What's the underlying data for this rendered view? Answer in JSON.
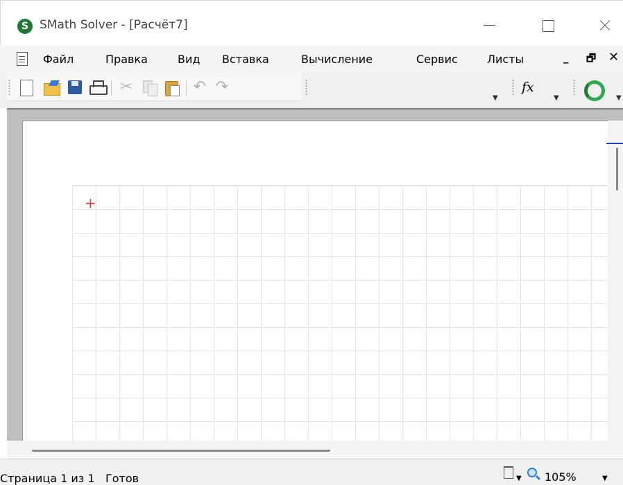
{
  "window": {
    "title": "SMath Solver - [Расчёт7]",
    "logo_letter": "S"
  },
  "menu": {
    "items": [
      "Файл",
      "Правка",
      "Вид",
      "Вставка",
      "Вычисление",
      "Сервис",
      "Листы"
    ]
  },
  "toolbar": {
    "icons": [
      "new-document-icon",
      "open-folder-icon",
      "save-icon",
      "print-icon",
      "cut-icon",
      "copy-icon",
      "paste-icon",
      "undo-icon",
      "redo-icon",
      "fx-function-icon",
      "recalculate-icon"
    ],
    "fx_label": "fx",
    "undo_glyph": "↶",
    "redo_glyph": "↷",
    "cut_glyph": "✂"
  },
  "worksheet": {
    "cursor_glyph": "+",
    "cursor_color": "#e53935"
  },
  "statusbar": {
    "page_info": "Страница 1 из 1",
    "state": "Готов",
    "zoom": "105%"
  },
  "colors": {
    "logo_green": "#1f7a3a",
    "page_marker_blue": "#1e3fc6"
  }
}
